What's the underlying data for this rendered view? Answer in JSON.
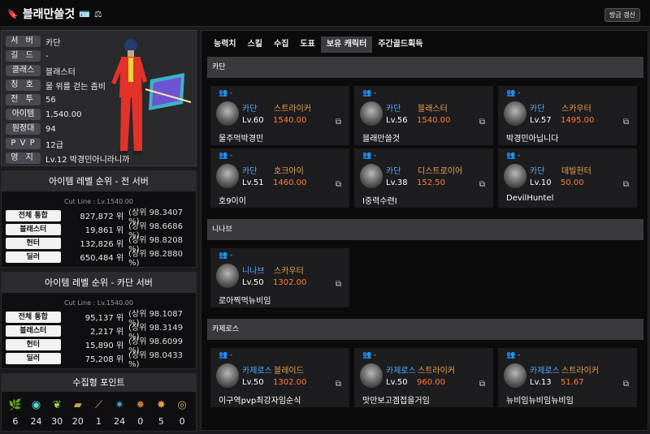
{
  "header": {
    "title": "블래만쓸것",
    "renew": "방금 갱신"
  },
  "profile": [
    {
      "label": "서 버",
      "value": "카단"
    },
    {
      "label": "길 드",
      "value": "-"
    },
    {
      "label": "클래스",
      "value": "블래스터"
    },
    {
      "label": "칭 호",
      "value": "물 위를 걷는 좀비"
    },
    {
      "label": "전 투",
      "value": "56"
    },
    {
      "label": "아이템",
      "value": "1,540.00"
    },
    {
      "label": "원정대",
      "value": "94"
    },
    {
      "label": "P V P",
      "value": "12급"
    },
    {
      "label": "영 지",
      "value": "Lv.12 박경민아니라니까"
    }
  ],
  "rank_all": {
    "title": "아이템 레벨 순위 - 전 서버",
    "cut": "Cut Line : Lv.1540.00",
    "rows": [
      {
        "label": "전체 통합",
        "value": "827,872 위",
        "pct": "(상위 98.3407 %)"
      },
      {
        "label": "블래스터",
        "value": "19,861 위",
        "pct": "(상위 98.6686 %)"
      },
      {
        "label": "헌터",
        "value": "132,826 위",
        "pct": "(상위 98.8208 %)"
      },
      {
        "label": "딜러",
        "value": "650,484 위",
        "pct": "(상위 98.2880 %)"
      }
    ]
  },
  "rank_server": {
    "title": "아이템 레벨 순위 - 카단 서버",
    "cut": "Cut Line : Lv.1540.00",
    "rows": [
      {
        "label": "전체 통합",
        "value": "95,137 위",
        "pct": "(상위 98.1087 %)"
      },
      {
        "label": "블래스터",
        "value": "2,217 위",
        "pct": "(상위 98.3149 %)"
      },
      {
        "label": "헌터",
        "value": "15,890 위",
        "pct": "(상위 98.6099 %)"
      },
      {
        "label": "딜러",
        "value": "75,208 위",
        "pct": "(상위 98.0433 %)"
      }
    ]
  },
  "collection": {
    "title": "수집형 포인트",
    "items": [
      {
        "icon": "mokoko-seed-icon",
        "count": "6",
        "glyph": "🌿",
        "color": "#cfd6c4"
      },
      {
        "icon": "island-heart-icon",
        "count": "24",
        "glyph": "◉",
        "color": "#59d8d0"
      },
      {
        "icon": "giant-heart-icon",
        "count": "30",
        "glyph": "❦",
        "color": "#9fd650"
      },
      {
        "icon": "art-icon",
        "count": "20",
        "glyph": "▰",
        "color": "#c9a55d"
      },
      {
        "icon": "voyage-icon",
        "count": "1",
        "glyph": "⟋",
        "color": "#e3b34f"
      },
      {
        "icon": "ignea-token-icon",
        "count": "24",
        "glyph": "✷",
        "color": "#4d9bd8"
      },
      {
        "icon": "orpheus-star-icon",
        "count": "0",
        "glyph": "✹",
        "color": "#c07a45"
      },
      {
        "icon": "world-tree-leaf-icon",
        "count": "5",
        "glyph": "✸",
        "color": "#e3a24a"
      },
      {
        "icon": "sea-bounty-icon",
        "count": "0",
        "glyph": "◎",
        "color": "#d8b056"
      }
    ]
  },
  "tabs": [
    "능력치",
    "스킬",
    "수집",
    "도표",
    "보유 캐릭터",
    "주간골드획득"
  ],
  "active_tab": "보유 캐릭터",
  "servers": [
    {
      "name": "카단",
      "chars": [
        {
          "server": "카단",
          "class": "스트라이커",
          "lv": "Lv.60",
          "ilvl": "1540.00",
          "name": "물주먹박경민",
          "guild": "-"
        },
        {
          "server": "카단",
          "class": "블래스터",
          "lv": "Lv.56",
          "ilvl": "1540.00",
          "name": "블래만쓸것",
          "guild": "-"
        },
        {
          "server": "카단",
          "class": "스카우터",
          "lv": "Lv.57",
          "ilvl": "1495.00",
          "name": "박경민아닙니다",
          "guild": "-"
        },
        {
          "server": "카단",
          "class": "호크아이",
          "lv": "Lv.51",
          "ilvl": "1460.00",
          "name": "호9이이",
          "guild": "-"
        },
        {
          "server": "카단",
          "class": "디스트로이어",
          "lv": "Lv.38",
          "ilvl": "152.50",
          "name": "I중력수련I",
          "guild": "-"
        },
        {
          "server": "카단",
          "class": "데빌헌터",
          "lv": "Lv.10",
          "ilvl": "50.00",
          "name": "DevilHuntel",
          "guild": "-"
        }
      ]
    },
    {
      "name": "니나브",
      "chars": [
        {
          "server": "니나브",
          "class": "스카우터",
          "lv": "Lv.50",
          "ilvl": "1302.00",
          "name": "로아찍먹뉴비임",
          "guild": "-"
        }
      ]
    },
    {
      "name": "카제로스",
      "chars": [
        {
          "server": "카제로스",
          "class": "블레이드",
          "lv": "Lv.50",
          "ilvl": "1302.00",
          "name": "이구역pvp최강자임순식",
          "guild": "-"
        },
        {
          "server": "카제로스",
          "class": "스트라이커",
          "lv": "Lv.50",
          "ilvl": "960.00",
          "name": "맛만보고겜접을거임",
          "guild": "-"
        },
        {
          "server": "카제로스",
          "class": "스트라이커",
          "lv": "Lv.13",
          "ilvl": "51.67",
          "name": "뉴비임뉴비임뉴비임",
          "guild": "-"
        }
      ]
    }
  ]
}
